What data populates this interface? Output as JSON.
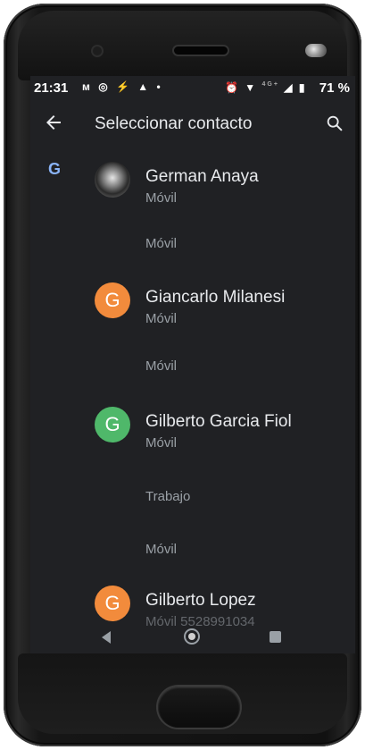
{
  "status_bar": {
    "time": "21:31",
    "left_icons": "ᴍ ◎ ⚡ ▲ •",
    "right_icons": "⏰ ▼",
    "network": "4G+",
    "signal": "◢ ▮",
    "battery": "71 %"
  },
  "appbar": {
    "title": "Seleccionar contacto"
  },
  "list": {
    "section_letter": "G",
    "contacts": [
      {
        "name": "German Anaya",
        "type": "Móvil",
        "avatar_kind": "photo",
        "extra_rows": [
          "Móvil"
        ]
      },
      {
        "name": "Giancarlo Milanesi",
        "type": "Móvil",
        "avatar_letter": "G",
        "avatar_color": "#f28b3c",
        "extra_rows": [
          "Móvil"
        ]
      },
      {
        "name": "Gilberto Garcia Fiol",
        "type": "Móvil",
        "avatar_letter": "G",
        "avatar_color": "#4fb86a",
        "extra_rows": [
          "Trabajo",
          "Móvil"
        ]
      },
      {
        "name": "Gilberto Lopez",
        "type": "Móvil 5528991034",
        "avatar_letter": "G",
        "avatar_color": "#f28b3c",
        "extra_rows": []
      }
    ]
  },
  "colors": {
    "screen_bg": "#202124",
    "primary_text": "#e8eaed",
    "secondary_text": "#9aa0a6",
    "section_letter": "#8ab4f8"
  },
  "icons": {
    "back": "arrow-back-icon",
    "search": "search-icon",
    "nav_back": "nav-back-icon",
    "nav_home": "nav-home-icon",
    "nav_recents": "nav-recents-icon"
  }
}
